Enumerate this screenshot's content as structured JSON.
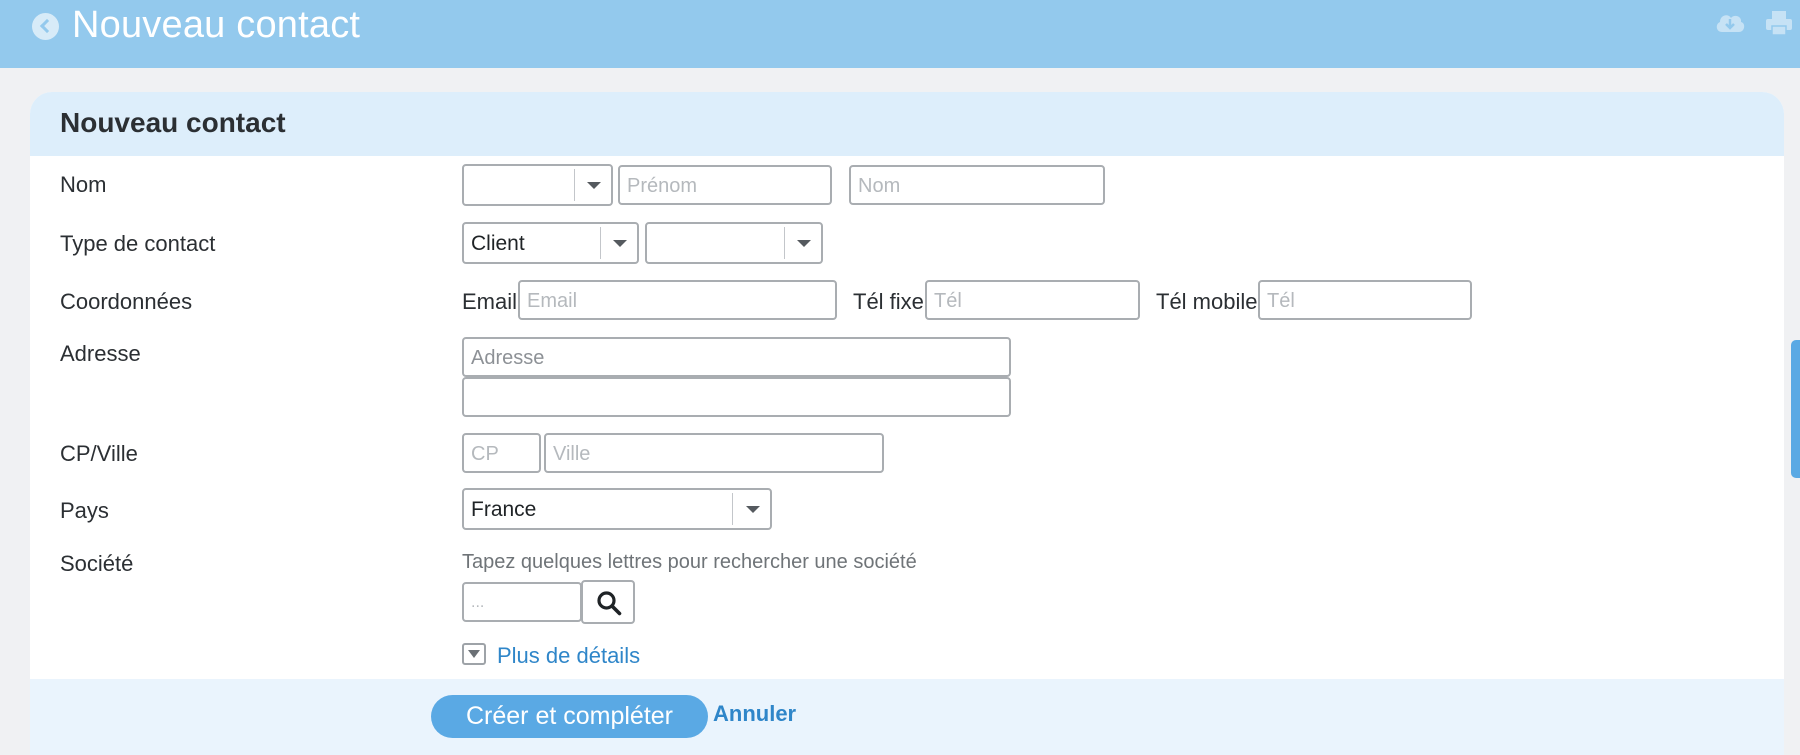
{
  "header": {
    "title": "Nouveau contact",
    "icons": [
      "back-arrow-icon",
      "cloud-download-icon",
      "print-icon"
    ],
    "background_color": "#93c9ed"
  },
  "form": {
    "title": "Nouveau contact",
    "nom": {
      "label": "Nom",
      "civility_value": "",
      "prenom_placeholder": "Prénom",
      "nom_placeholder": "Nom"
    },
    "type_contact": {
      "label": "Type de contact",
      "type_value": "Client",
      "subtype_value": ""
    },
    "coordonnees": {
      "label": "Coordonnées",
      "email_label": "Email",
      "email_placeholder": "Email",
      "tel_fixe_label": "Tél fixe",
      "tel_fixe_placeholder": "Tél",
      "tel_mobile_label": "Tél mobile",
      "tel_mobile_placeholder": "Tél"
    },
    "adresse": {
      "label": "Adresse",
      "line1_placeholder": "Adresse",
      "line2_placeholder": ""
    },
    "cp_ville": {
      "label": "CP/Ville",
      "cp_placeholder": "CP",
      "ville_placeholder": "Ville"
    },
    "pays": {
      "label": "Pays",
      "value": "France"
    },
    "societe": {
      "label": "Société",
      "hint": "Tapez quelques lettres pour rechercher une société",
      "search_placeholder": "..."
    },
    "more_details": "Plus de détails"
  },
  "actions": {
    "submit": "Créer et compléter",
    "cancel": "Annuler"
  },
  "colors": {
    "accent": "#5aa9e4",
    "link": "#2f86c9",
    "panel_header": "#ddeefb"
  }
}
